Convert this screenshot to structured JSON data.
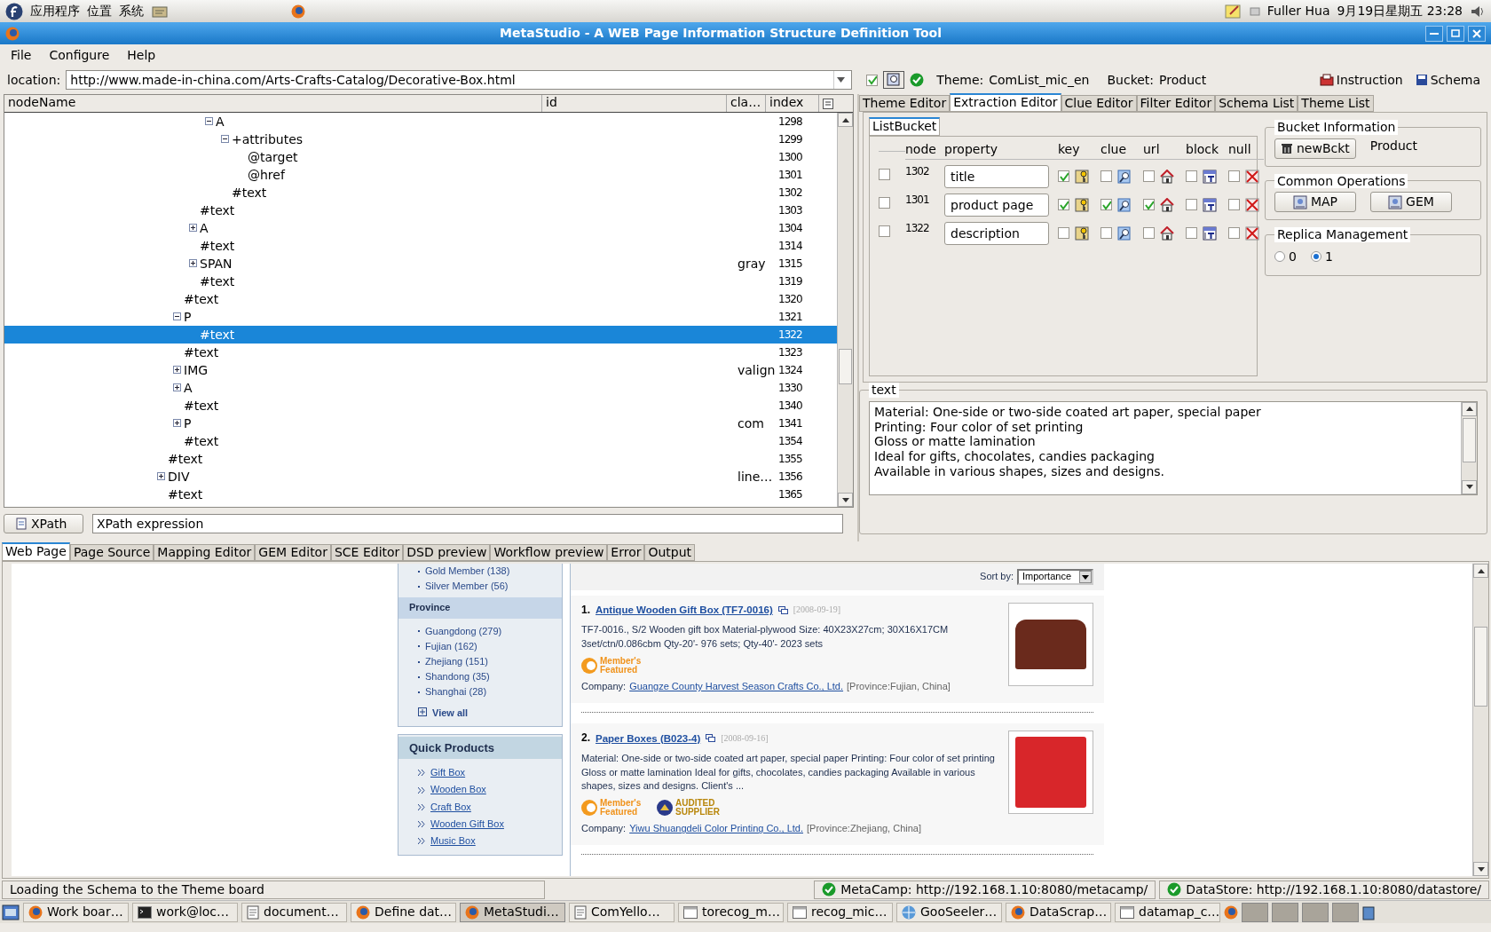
{
  "top_panel": {
    "menus": [
      "应用程序",
      "位置",
      "系统"
    ],
    "user": "Fuller Hua",
    "clock": "9月19日星期五 23:28"
  },
  "window": {
    "title": "MetaStudio - A WEB Page Information Structure Definition Tool"
  },
  "menu": [
    "File",
    "Configure",
    "Help"
  ],
  "toolbar": {
    "location_label": "location:",
    "location": "http://www.made-in-china.com/Arts-Crafts-Catalog/Decorative-Box.html",
    "option_checked": true,
    "theme_label": "Theme:",
    "theme": "ComList_mic_en",
    "bucket_label": "Bucket:",
    "bucket": "Product",
    "buttons": [
      {
        "label": "Instruction",
        "kind": "instruction"
      },
      {
        "label": "Schema",
        "kind": "save"
      }
    ]
  },
  "dom_tree": {
    "columns": [
      "nodeName",
      "id",
      "cla…",
      "index"
    ],
    "nodes": [
      {
        "children": [
          {
            "children": [
              {
                "children": [
                  {
                    "name": "A",
                    "index": "1298",
                    "expanded": true,
                    "selected": false,
                    "children": [
                      {
                        "name": "+attributes",
                        "index": "1299",
                        "expanded": true,
                        "selected": false,
                        "children": [
                          {
                            "name": "@target",
                            "index": "1300",
                            "selected": false
                          },
                          {
                            "name": "@href",
                            "index": "1301",
                            "selected": false
                          }
                        ]
                      },
                      {
                        "name": "#text",
                        "index": "1302",
                        "selected": false
                      }
                    ]
                  }
                ]
              },
              {
                "name": "#text",
                "index": "1303",
                "selected": false
              },
              {
                "name": "A",
                "index": "1304",
                "expanded": false,
                "selected": false
              },
              {
                "name": "#text",
                "index": "1314",
                "selected": false
              },
              {
                "name": "SPAN",
                "class": "gray",
                "index": "1315",
                "expanded": false,
                "selected": false
              },
              {
                "name": "#text",
                "index": "1319",
                "selected": false
              }
            ]
          },
          {
            "name": "#text",
            "index": "1320",
            "selected": false
          },
          {
            "name": "P",
            "index": "1321",
            "expanded": true,
            "selected": false,
            "children": [
              {
                "name": "#text",
                "index": "1322",
                "selected": true
              }
            ]
          },
          {
            "name": "#text",
            "index": "1323",
            "selected": false
          },
          {
            "name": "IMG",
            "class": "valign",
            "index": "1324",
            "expanded": false,
            "selected": false
          },
          {
            "name": "A",
            "index": "1330",
            "expanded": false,
            "selected": false
          },
          {
            "name": "#text",
            "index": "1340",
            "selected": false
          },
          {
            "name": "P",
            "class": "com",
            "index": "1341",
            "expanded": false,
            "selected": false
          },
          {
            "name": "#text",
            "index": "1354",
            "selected": false
          }
        ]
      },
      {
        "name": "#text",
        "index": "1355",
        "selected": false
      },
      {
        "name": "DIV",
        "class": "line…",
        "index": "1356",
        "expanded": false,
        "selected": false
      },
      {
        "name": "#text",
        "index": "1365",
        "selected": false
      }
    ]
  },
  "xpath": {
    "button": "XPath",
    "value": "XPath expression"
  },
  "editor_tabs": [
    {
      "label": "Theme Editor",
      "selected": false
    },
    {
      "label": "Extraction Editor",
      "selected": true
    },
    {
      "label": "Clue Editor",
      "selected": false
    },
    {
      "label": "Filter Editor",
      "selected": false
    },
    {
      "label": "Schema List",
      "selected": false
    },
    {
      "label": "Theme List",
      "selected": false
    }
  ],
  "list_bucket": {
    "tab": "ListBucket",
    "columns": [
      "node",
      "property",
      "key",
      "clue",
      "url",
      "block",
      "null"
    ],
    "rows": [
      {
        "checked": false,
        "node": "1302",
        "property": "title",
        "key": true,
        "clue": false,
        "url": false,
        "block": false,
        "null": false
      },
      {
        "checked": false,
        "node": "1301",
        "property": "product page",
        "key": true,
        "clue": true,
        "url": true,
        "block": false,
        "null": false
      },
      {
        "checked": false,
        "node": "1322",
        "property": "description",
        "key": false,
        "clue": false,
        "url": false,
        "block": false,
        "null": false
      }
    ]
  },
  "bucket_information": {
    "title": "Bucket Information",
    "button": "newBckt",
    "name": "Product"
  },
  "common_operations": {
    "title": "Common Operations",
    "buttons": [
      "MAP",
      "GEM"
    ]
  },
  "replica_management": {
    "title": "Replica Management",
    "options": [
      {
        "label": "0",
        "selected": false
      },
      {
        "label": "1",
        "selected": true
      }
    ]
  },
  "text_panel": {
    "title": "text",
    "lines": [
      "Material: One-side or two-side coated art paper, special paper",
      "Printing: Four color of set printing",
      "Gloss or matte lamination",
      "Ideal for gifts, chocolates, candies packaging",
      "Available in various shapes, sizes and designs."
    ]
  },
  "bottom_tabs": [
    {
      "label": "Web Page",
      "selected": true
    },
    {
      "label": "Page Source",
      "selected": false
    },
    {
      "label": "Mapping Editor",
      "selected": false
    },
    {
      "label": "GEM Editor",
      "selected": false
    },
    {
      "label": "SCE Editor",
      "selected": false
    },
    {
      "label": "DSD preview",
      "selected": false
    },
    {
      "label": "Workflow preview",
      "selected": false
    },
    {
      "label": "Error",
      "selected": false
    },
    {
      "label": "Output",
      "selected": false
    }
  ],
  "web_page": {
    "member_filters": [
      "Gold Member (138)",
      "Silver Member (56)"
    ],
    "province_title": "Province",
    "provinces": [
      "Guangdong (279)",
      "Fujian (162)",
      "Zhejiang (151)",
      "Shandong (35)",
      "Shanghai (28)"
    ],
    "view_all": "View all",
    "quick_title": "Quick Products",
    "quick_products": [
      "Gift Box",
      "Wooden Box",
      "Craft Box",
      "Wooden Gift Box",
      "Music Box"
    ],
    "sort_label": "Sort by:",
    "sort_value": "Importance",
    "products": [
      {
        "number": "1.",
        "title": "Antique Wooden Gift Box (TF7-0016)",
        "date": "[2008-09-19]",
        "description": "TF7-0016., S/2 Wooden gift box Material-plywood Size: 40X23X27cm; 30X16X17CM 3set/ctn/0.086cbm Qty-20'- 976 sets; Qty-40'- 2023 sets",
        "badges": [
          {
            "kind": "member",
            "label": "Member's Featured"
          }
        ],
        "company_label": "Company:",
        "company": "Guangze County Harvest Season Crafts Co., Ltd.",
        "province": "[Province:Fujian, China]"
      },
      {
        "number": "2.",
        "title": "Paper Boxes (B023-4)",
        "date": "[2008-09-16]",
        "description": "Material: One-side or two-side coated art paper, special paper Printing: Four color of set printing Gloss or matte lamination Ideal for gifts, chocolates, candies packaging Available in various shapes, sizes and designs. Client's ...",
        "badges": [
          {
            "kind": "member",
            "label": "Member's Featured"
          },
          {
            "kind": "audited",
            "label": "AUDITED SUPPLIER"
          }
        ],
        "company_label": "Company:",
        "company": "Yiwu Shuangdeli Color Printing Co., Ltd.",
        "province": "[Province:Zhejiang, China]"
      }
    ]
  },
  "status_bar": {
    "message": "Loading the Schema to the Theme board",
    "services": [
      "MetaCamp: http://192.168.1.10:8080/metacamp/",
      "DataStore: http://192.168.1.10:8080/datastore/"
    ]
  },
  "taskbar": [
    {
      "label": "Work boar…",
      "kind": "browser",
      "selected": false
    },
    {
      "label": "work@loc…",
      "kind": "terminal",
      "selected": false
    },
    {
      "label": "document…",
      "kind": "document",
      "selected": false
    },
    {
      "label": "Define dat…",
      "kind": "browser",
      "selected": false
    },
    {
      "label": "MetaStudi…",
      "kind": "browser",
      "selected": true
    },
    {
      "label": "ComYello…",
      "kind": "document",
      "selected": false
    },
    {
      "label": "torecog_m…",
      "kind": "window",
      "selected": false
    },
    {
      "label": "recog_mic…",
      "kind": "window",
      "selected": false
    },
    {
      "label": "GooSeeler…",
      "kind": "web",
      "selected": false
    },
    {
      "label": "DataScrap…",
      "kind": "browser",
      "selected": false
    },
    {
      "label": "datamap_c…",
      "kind": "window",
      "selected": false
    }
  ]
}
